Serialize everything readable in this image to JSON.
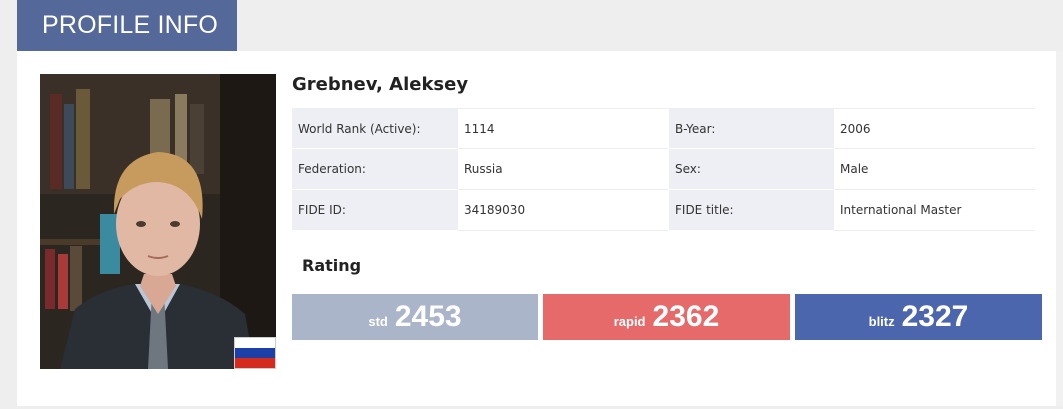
{
  "header": {
    "title": "PROFILE INFO"
  },
  "player": {
    "name": "Grebnev, Aleksey",
    "flag_colors": [
      "#ffffff",
      "#1c3fa8",
      "#d52b1e"
    ]
  },
  "info": {
    "world_rank_label": "World Rank (Active):",
    "world_rank_value": "1114",
    "byear_label": "B-Year:",
    "byear_value": "2006",
    "federation_label": "Federation:",
    "federation_value": "Russia",
    "sex_label": "Sex:",
    "sex_value": "Male",
    "fide_id_label": "FIDE ID:",
    "fide_id_value": "34189030",
    "fide_title_label": "FIDE title:",
    "fide_title_value": "International Master"
  },
  "rating": {
    "title": "Rating",
    "std_label": "std",
    "std_value": "2453",
    "rapid_label": "rapid",
    "rapid_value": "2362",
    "blitz_label": "blitz",
    "blitz_value": "2327"
  },
  "colors": {
    "header": "#55689a",
    "std": "#aab5ca",
    "rapid": "#e76a6b",
    "blitz": "#4c66ad"
  }
}
